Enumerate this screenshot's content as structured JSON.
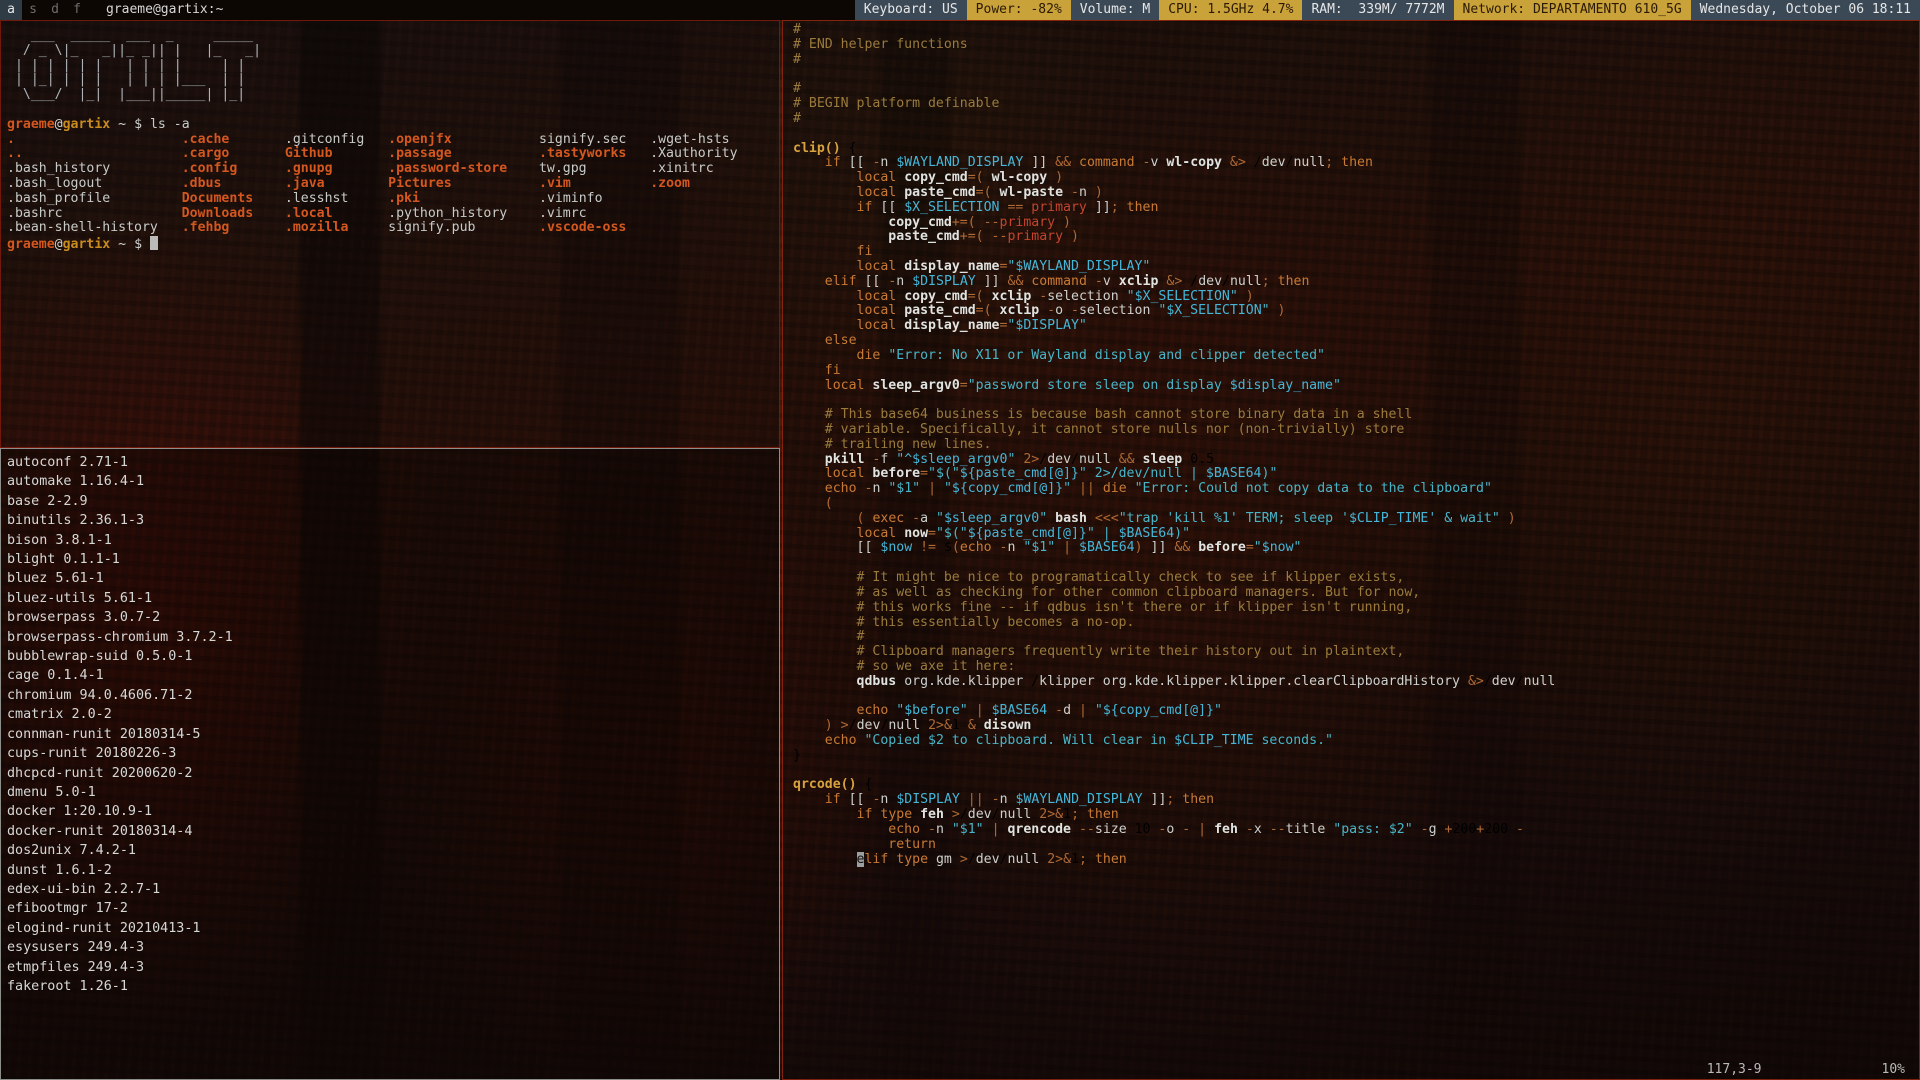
{
  "topbar": {
    "tags": [
      {
        "label": "a",
        "active": true
      },
      {
        "label": "s",
        "active": false
      },
      {
        "label": "d",
        "active": false
      },
      {
        "label": "f",
        "active": false
      }
    ],
    "window_title": "graeme@gartix:~",
    "status_blocks": [
      {
        "text": "Keyboard: US",
        "style": "grey"
      },
      {
        "text": "Power: -82%",
        "style": "gold"
      },
      {
        "text": "Volume: M",
        "style": "grey"
      },
      {
        "text": "CPU: 1.5GHz 4.7%",
        "style": "gold"
      },
      {
        "text": "RAM:  339M/ 7772M",
        "style": "grey"
      },
      {
        "text": "Network: DEPARTAMENTO 610_5G",
        "style": "gold"
      },
      {
        "text": "Wednesday, October 06 18:11",
        "style": "grey"
      }
    ]
  },
  "terminal": {
    "ascii_art": [
      "  ____ ______ ___ _  ______",
      " / _ \\ _| _ | | _____|",
      "| |_| || | | | ||  |  | |____|",
      "|  _| || | | | ||  |  |  ___|",
      " \\__\\_\\|_| |___|_____|_____|"
    ],
    "ascii_lines": [
      "   ___  _____  ___  _     _____",
      "  / _ \\|_   _||_ _|| |   |_   _|",
      " | | | | | |   | | | |     | |",
      " | |_| | | |   | | | |___  | |",
      "  \\___/  |_|  |___||_____| |_|"
    ],
    "prompt": {
      "user": "graeme",
      "at": "@",
      "host": "gartix",
      "path": " ~ ",
      "sym": "$ "
    },
    "command": "ls -a",
    "ls_columns": [
      [
        ".",
        "..",
        ".bash_history",
        ".bash_logout",
        ".bash_profile",
        ".bashrc",
        ".bean-shell-history"
      ],
      [
        ".cache",
        ".cargo",
        ".config",
        ".dbus",
        "Documents",
        "Downloads",
        ".fehbg"
      ],
      [
        ".gitconfig",
        "Github",
        ".gnupg",
        ".java",
        ".lesshst",
        ".local",
        ".mozilla"
      ],
      [
        ".openjfx",
        ".passage",
        ".password-store",
        "Pictures",
        ".pki",
        ".python_history",
        "signify.pub"
      ],
      [
        "signify.sec",
        ".tastyworks",
        "tw.gpg",
        ".vim",
        ".viminfo",
        ".vimrc",
        ".vscode-oss"
      ],
      [
        ".wget-hsts",
        ".Xauthority",
        ".xinitrc",
        ".zoom",
        "",
        "",
        ""
      ]
    ],
    "ls_types": [
      [
        "dir",
        "dir",
        "file",
        "file",
        "file",
        "file",
        "file"
      ],
      [
        "dir",
        "dir",
        "dir",
        "dir",
        "dir",
        "dir",
        "dir"
      ],
      [
        "file",
        "dir",
        "dir",
        "dir",
        "file",
        "dir",
        "dir"
      ],
      [
        "dir",
        "dir",
        "dir",
        "dir",
        "dir",
        "file",
        "file"
      ],
      [
        "file",
        "dir",
        "file",
        "dir",
        "file",
        "file",
        "dir"
      ],
      [
        "file",
        "file",
        "file",
        "dir",
        "",
        "",
        ""
      ]
    ]
  },
  "packages": {
    "lines": [
      "autoconf 2.71-1",
      "automake 1.16.4-1",
      "base 2-2.9",
      "binutils 2.36.1-3",
      "bison 3.8.1-1",
      "blight 0.1.1-1",
      "bluez 5.61-1",
      "bluez-utils 5.61-1",
      "browserpass 3.0.7-2",
      "browserpass-chromium 3.7.2-1",
      "bubblewrap-suid 0.5.0-1",
      "cage 0.1.4-1",
      "chromium 94.0.4606.71-2",
      "cmatrix 2.0-2",
      "connman-runit 20180314-5",
      "cups-runit 20180226-3",
      "dhcpcd-runit 20200620-2",
      "dmenu 5.0-1",
      "docker 1:20.10.9-1",
      "docker-runit 20180314-4",
      "dos2unix 7.4.2-1",
      "dunst 1.6.1-2",
      "edex-ui-bin 2.2.7-1",
      "efibootmgr 17-2",
      "elogind-runit 20210413-1",
      "esysusers 249.4-3",
      "etmpfiles 249.4-3",
      "fakeroot 1.26-1"
    ]
  },
  "editor": {
    "status_position": "117,3-9",
    "status_percent": "10%",
    "code_lines": [
      "#",
      "# END helper functions",
      "#",
      "",
      "#",
      "# BEGIN platform definable",
      "#",
      "",
      "clip() {",
      "    if [[ -n $WAYLAND_DISPLAY ]] && command -v wl-copy &> /dev/null; then",
      "        local copy_cmd=( wl-copy )",
      "        local paste_cmd=( wl-paste -n )",
      "        if [[ $X_SELECTION == primary ]]; then",
      "            copy_cmd+=( --primary )",
      "            paste_cmd+=( --primary )",
      "        fi",
      "        local display_name=\"$WAYLAND_DISPLAY\"",
      "    elif [[ -n $DISPLAY ]] && command -v xclip &> /dev/null; then",
      "        local copy_cmd=( xclip -selection \"$X_SELECTION\" )",
      "        local paste_cmd=( xclip -o -selection \"$X_SELECTION\" )",
      "        local display_name=\"$DISPLAY\"",
      "    else",
      "        die \"Error: No X11 or Wayland display and clipper detected\"",
      "    fi",
      "    local sleep_argv0=\"password store sleep on display $display_name\"",
      "",
      "    # This base64 business is because bash cannot store binary data in a shell",
      "    # variable. Specifically, it cannot store nulls nor (non-trivially) store",
      "    # trailing new lines.",
      "    pkill -f \"^$sleep_argv0\" 2>/dev/null && sleep 0.5",
      "    local before=\"$(\"${paste_cmd[@]}\" 2>/dev/null | $BASE64)\"",
      "    echo -n \"$1\" | \"${copy_cmd[@]}\" || die \"Error: Could not copy data to the clipboard\"",
      "    (",
      "        ( exec -a \"$sleep_argv0\" bash <<<\"trap 'kill %1' TERM; sleep '$CLIP_TIME' & wait\" )",
      "        local now=\"$(\"${paste_cmd[@]}\" | $BASE64)\"",
      "        [[ $now != $(echo -n \"$1\" | $BASE64) ]] && before=\"$now\"",
      "",
      "        # It might be nice to programatically check to see if klipper exists,",
      "        # as well as checking for other common clipboard managers. But for now,",
      "        # this works fine -- if qdbus isn't there or if klipper isn't running,",
      "        # this essentially becomes a no-op.",
      "        #",
      "        # Clipboard managers frequently write their history out in plaintext,",
      "        # so we axe it here:",
      "        qdbus org.kde.klipper /klipper org.kde.klipper.klipper.clearClipboardHistory &>/dev/null",
      "",
      "        echo \"$before\" | $BASE64 -d | \"${copy_cmd[@]}\"",
      "    ) >/dev/null 2>&1 & disown",
      "    echo \"Copied $2 to clipboard. Will clear in $CLIP_TIME seconds.\"",
      "}",
      "",
      "qrcode() {",
      "    if [[ -n $DISPLAY || -n $WAYLAND_DISPLAY ]]; then",
      "        if type feh >/dev/null 2>&1; then",
      "            echo -n \"$1\" | qrencode --size 10 -o - | feh -x --title \"pass: $2\" -g +200+200 -",
      "            return",
      "        elif type gm >/dev/null 2>&1; then"
    ]
  }
}
